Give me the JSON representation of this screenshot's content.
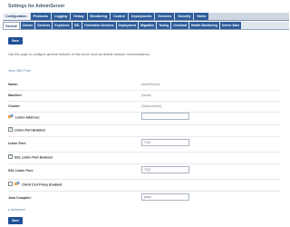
{
  "window": {
    "title": "Settings for AdminServer"
  },
  "main_tabs": [
    {
      "label": "Configuration",
      "active": true
    },
    {
      "label": "Protocols"
    },
    {
      "label": "Logging"
    },
    {
      "label": "Debug"
    },
    {
      "label": "Monitoring"
    },
    {
      "label": "Control"
    },
    {
      "label": "Deployments"
    },
    {
      "label": "Services"
    },
    {
      "label": "Security"
    },
    {
      "label": "Notes"
    }
  ],
  "sub_tabs": [
    {
      "label": "General",
      "active": true
    },
    {
      "label": "Cluster"
    },
    {
      "label": "Services"
    },
    {
      "label": "Keystores"
    },
    {
      "label": "SSL"
    },
    {
      "label": "Federation Services"
    },
    {
      "label": "Deployment"
    },
    {
      "label": "Migration"
    },
    {
      "label": "Tuning"
    },
    {
      "label": "Overload"
    },
    {
      "label": "Health Monitoring"
    },
    {
      "label": "Server Start"
    }
  ],
  "toolbar": {
    "save_label": "Save"
  },
  "description": "Use this page to configure general features of this server such as default network communications.",
  "jndi_link": "View JNDI Tree",
  "fields": {
    "name": {
      "label": "Name:",
      "value": "AdminServer"
    },
    "machine": {
      "label": "Machine:",
      "value": "(None)"
    },
    "cluster": {
      "label": "Cluster:",
      "value": "(Stand-Alone)"
    },
    "listen_address": {
      "label": "Listen Address:",
      "value": ""
    },
    "listen_port_enabled": {
      "label": "Listen Port Enabled",
      "checked": true
    },
    "listen_port": {
      "label": "Listen Port:",
      "value": "7001"
    },
    "ssl_listen_port_enabled": {
      "label": "SSL Listen Port Enabled",
      "checked": true
    },
    "ssl_listen_port": {
      "label": "SSL Listen Port:",
      "value": "7002"
    },
    "client_cert_proxy": {
      "label": "Client Cert Proxy Enabled",
      "checked": false
    },
    "java_compiler": {
      "label": "Java Compiler:",
      "value": "javac"
    }
  },
  "advanced_label": "Advanced",
  "colors": {
    "tab_blue": "#2f5d9b",
    "button_blue": "#1f4f96",
    "link_blue": "#5c7ba8"
  }
}
